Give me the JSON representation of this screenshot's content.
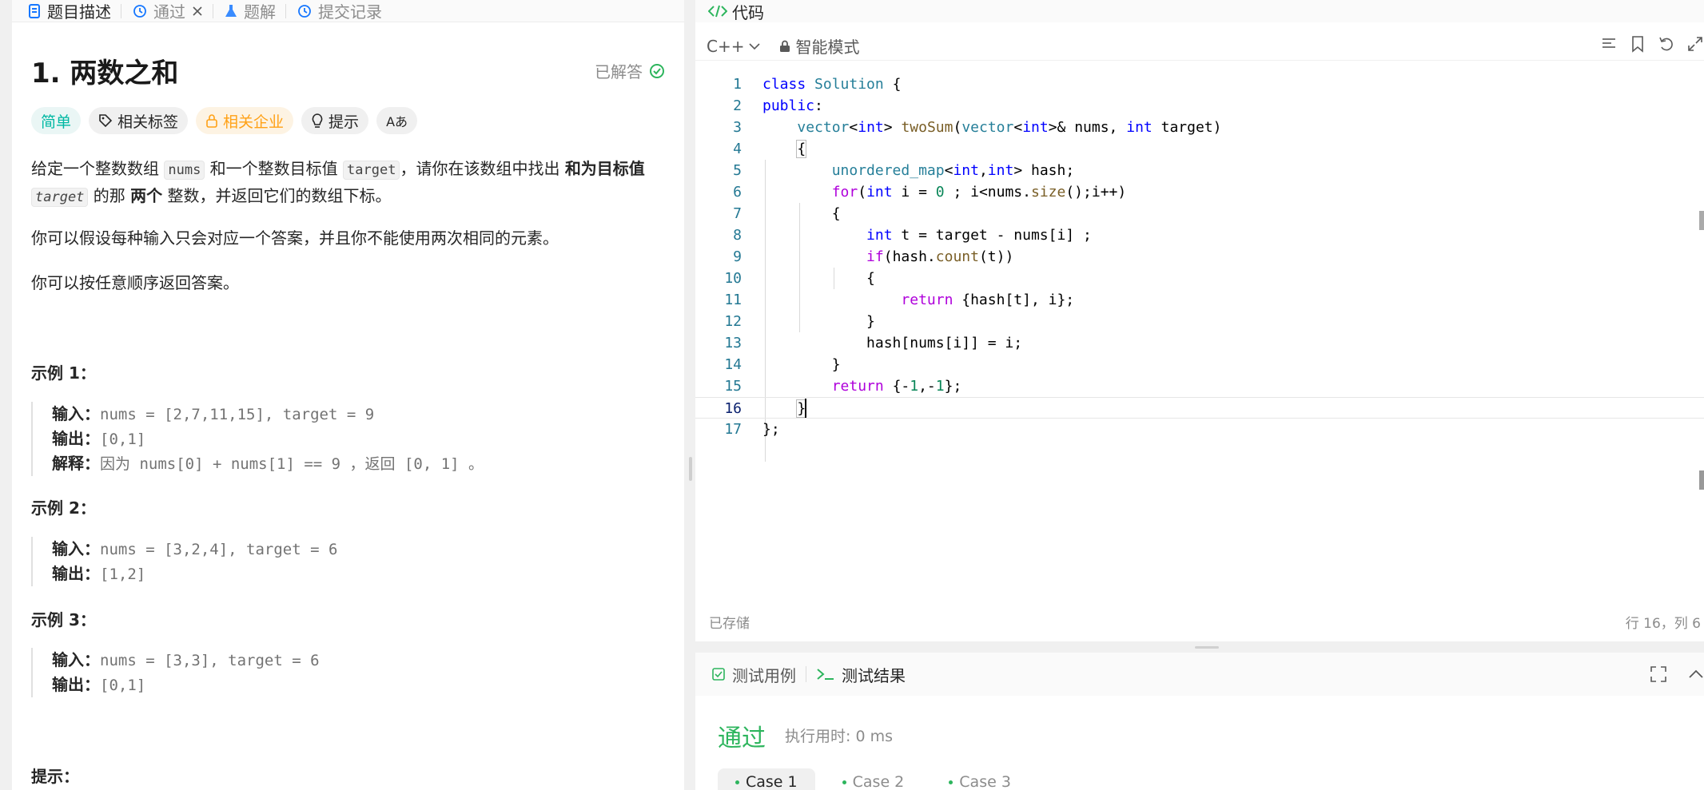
{
  "left_tabs": [
    {
      "label": "题目描述",
      "icon": "document-icon",
      "active": true
    },
    {
      "label": "通过",
      "icon": "history-icon",
      "active": false,
      "closable": true
    },
    {
      "label": "题解",
      "icon": "flask-icon",
      "active": false
    },
    {
      "label": "提交记录",
      "icon": "history-icon",
      "active": false
    }
  ],
  "problem": {
    "title": "1. 两数之和",
    "status": "已解答",
    "tags": {
      "difficulty": "简单",
      "related_tags": "相关标签",
      "related_companies": "相关企业",
      "hints": "提示",
      "translate": "Aあ"
    },
    "desc": {
      "p1_a": "给定一个整数数组 ",
      "p1_code1": "nums",
      "p1_b": " 和一个整数目标值 ",
      "p1_code2": "target",
      "p1_c": "，请你在该数组中找出 ",
      "p1_bold1": "和为目标值",
      "p1_code3": "target",
      "p1_d": " 的那 ",
      "p1_bold2": "两个",
      "p1_e": " 整数，并返回它们的数组下标。",
      "p2": "你可以假设每种输入只会对应一个答案，并且你不能使用两次相同的元素。",
      "p3": "你可以按任意顺序返回答案。"
    },
    "examples": [
      {
        "title": "示例 1：",
        "input_label": "输入：",
        "input": "nums = [2,7,11,15], target = 9",
        "output_label": "输出：",
        "output": "[0,1]",
        "explain_label": "解释：",
        "explain": "因为 nums[0] + nums[1] == 9 ，返回 [0, 1] 。"
      },
      {
        "title": "示例 2：",
        "input_label": "输入：",
        "input": "nums = [3,2,4], target = 6",
        "output_label": "输出：",
        "output": "[1,2]"
      },
      {
        "title": "示例 3：",
        "input_label": "输入：",
        "input": "nums = [3,3], target = 6",
        "output_label": "输出：",
        "output": "[0,1]"
      }
    ],
    "hints_title": "提示："
  },
  "code": {
    "header": "代码",
    "language": "C++",
    "mode": "智能模式",
    "saved": "已存储",
    "cursor": "行 16，列 6",
    "line_numbers": [
      "1",
      "2",
      "3",
      "4",
      "5",
      "6",
      "7",
      "8",
      "9",
      "10",
      "11",
      "12",
      "13",
      "14",
      "15",
      "16",
      "17"
    ]
  },
  "test": {
    "tab_cases": "测试用例",
    "tab_results": "测试结果",
    "verdict": "通过",
    "runtime": "执行用时: 0 ms",
    "cases": [
      "Case 1",
      "Case 2",
      "Case 3"
    ]
  },
  "colors": {
    "accent_green": "#2db55d",
    "easy_teal": "#00b8a3",
    "company_orange": "#ffa116"
  }
}
